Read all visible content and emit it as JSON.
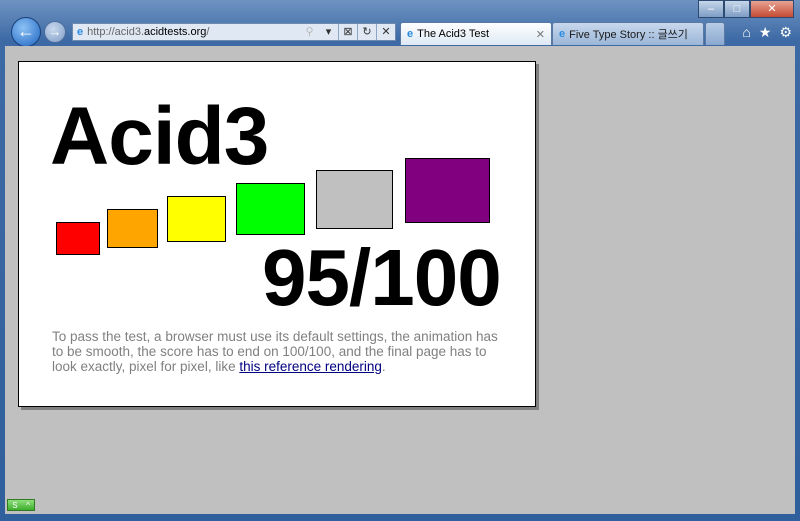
{
  "browser": {
    "address": {
      "prefix": "http://acid3.",
      "domain": "acidtests.org",
      "suffix": "/"
    },
    "tabs": [
      {
        "label": "The Acid3 Test",
        "active": true
      },
      {
        "label": "Five Type Story :: 글쓰기",
        "active": false
      }
    ]
  },
  "page": {
    "title": "Acid3",
    "score": "95/100",
    "boxes": [
      "#ff0000",
      "#ffa500",
      "#ffff00",
      "#00ff00",
      "#c0c0c0",
      "#800080"
    ],
    "description": "To pass the test, a browser must use its default settings, the animation has to be smooth, the score has to end on 100/100, and the final page has to look exactly, pixel for pixel, like ",
    "link": "this reference rendering",
    "end": "."
  }
}
